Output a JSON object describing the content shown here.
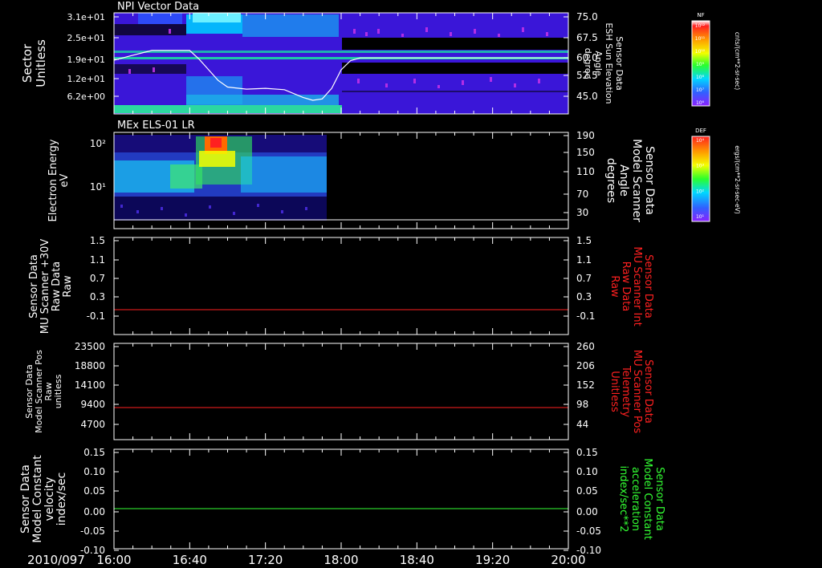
{
  "date_label": "2010/097",
  "x_ticks": [
    "16:00",
    "16:40",
    "17:20",
    "18:00",
    "18:40",
    "19:20",
    "20:00"
  ],
  "colors": {
    "frame": "#ffffff",
    "red_trace": "#ff2020",
    "green_trace": "#33ff33",
    "red_label": "#ff2020",
    "green_label": "#33ff33",
    "white_trace": "#ffffff"
  },
  "chart_data": [
    {
      "type": "heatmap",
      "title": "NPI Vector Data",
      "ylabel": [
        "Sector",
        "Unitless"
      ],
      "yticks_left": [
        "3.1e+01",
        "2.5e+01",
        "1.9e+01",
        "1.2e+01",
        "6.2e+00"
      ],
      "ylabel_right": [
        "Sensor Data",
        "ESH Sun Elevation",
        "Angle",
        "degree"
      ],
      "yticks_right": [
        "75.0",
        "67.5",
        "60.0",
        "52.5",
        "45.0"
      ],
      "ylim_right": [
        40,
        75
      ],
      "colorbar": {
        "title": "NF",
        "unit": "cnts/(cm**2-sr-sec)",
        "ticks": [
          "10¹²",
          "10¹¹",
          "10¹⁰",
          "10⁹",
          "10⁸",
          "10⁷",
          "10⁶"
        ]
      },
      "overlay_line": {
        "name": "ESH Sun Elevation Angle",
        "x": [
          "16:00",
          "16:10",
          "16:20",
          "16:30",
          "16:40",
          "16:45",
          "16:50",
          "16:55",
          "17:00",
          "17:10",
          "17:20",
          "17:30",
          "17:40",
          "17:45",
          "17:50",
          "17:55",
          "18:00",
          "18:05",
          "18:10",
          "18:20",
          "19:00",
          "20:00"
        ],
        "y": [
          58.6,
          60.5,
          62.3,
          62.3,
          62.3,
          59,
          55,
          51,
          48.5,
          47.7,
          48,
          47.5,
          44.5,
          43.5,
          44,
          48,
          55,
          58.5,
          59.5,
          59.5,
          59.5,
          59.5
        ]
      }
    },
    {
      "type": "heatmap",
      "title": "MEx ELS-01 LR",
      "ylabel": [
        "Electron Energy",
        "eV"
      ],
      "yticks_left": [
        "10²",
        "10¹"
      ],
      "ylabel_right": [
        "Sensor Data",
        "Model Scanner",
        "Angle",
        "degrees"
      ],
      "yticks_right": [
        "190",
        "150",
        "110",
        "70",
        "30"
      ],
      "ylim_right": [
        0,
        190
      ],
      "colorbar": {
        "title": "DEF",
        "unit": "ergs/(cm**2-sr-sec-eV)",
        "ticks": [
          "10⁴",
          "10³",
          "10²",
          "10¹"
        ]
      },
      "overlay_line": {
        "name": "Model Scanner Angle",
        "x": [
          "16:00",
          "20:00"
        ],
        "y": [
          4,
          4
        ]
      }
    },
    {
      "type": "line",
      "ylabel": [
        "Sensor Data",
        "MU Scanner +30V",
        "Raw Data",
        "Raw"
      ],
      "yticks_left": [
        "1.5",
        "1.1",
        "0.7",
        "0.3",
        "-0.1"
      ],
      "ylabel_right": [
        "Sensor Data",
        "MU Scanner Int",
        "Raw Data",
        "Raw"
      ],
      "yticks_right": [
        "1.5",
        "1.1",
        "0.7",
        "0.3",
        "-0.1"
      ],
      "ylim": [
        -0.3,
        1.5
      ],
      "series": [
        {
          "x": [
            "16:00",
            "20:00"
          ],
          "y": [
            0.0,
            0.0
          ]
        }
      ]
    },
    {
      "type": "line",
      "ylabel": [
        "Sensor Data",
        "Model Scanner Pos",
        "Raw",
        "unitless"
      ],
      "yticks_left": [
        "23500",
        "18800",
        "14100",
        "9400",
        "4700"
      ],
      "ylabel_right": [
        "Sensor Data",
        "MU Scanner Pos",
        "Telemetry",
        "Unitless"
      ],
      "yticks_right": [
        "260",
        "206",
        "152",
        "98",
        "44"
      ],
      "ylim": [
        0,
        23500
      ],
      "series": [
        {
          "x": [
            "16:00",
            "20:00"
          ],
          "y": [
            7900,
            7900
          ]
        }
      ]
    },
    {
      "type": "line",
      "ylabel": [
        "Sensor Data",
        "Model Constant",
        "velocity",
        "index/sec"
      ],
      "yticks_left": [
        "0.15",
        "0.10",
        "0.05",
        "0.00",
        "-0.05",
        "-0.10"
      ],
      "ylabel_right": [
        "Sensor Data",
        "Model Constant",
        "acceleration",
        "index/sec**2"
      ],
      "yticks_right": [
        "0.15",
        "0.10",
        "0.05",
        "0.00",
        "-0.05",
        "-0.10"
      ],
      "ylim": [
        -0.1,
        0.15
      ],
      "series": [
        {
          "x": [
            "16:00",
            "20:00"
          ],
          "y": [
            0.0,
            0.0
          ]
        }
      ]
    }
  ]
}
